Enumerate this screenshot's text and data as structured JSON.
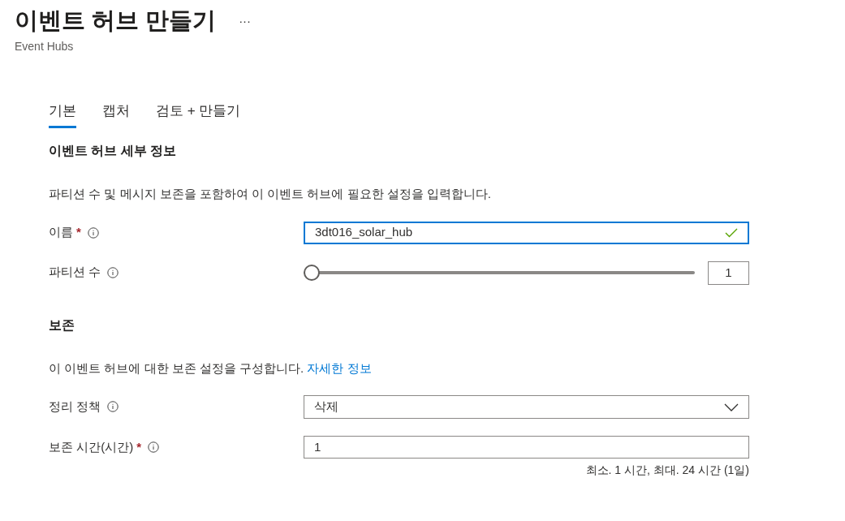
{
  "header": {
    "title": "이벤트 허브 만들기",
    "more": "···",
    "subtitle": "Event Hubs"
  },
  "tabs": [
    {
      "label": "기본",
      "selected": true
    },
    {
      "label": "캡처",
      "selected": false
    },
    {
      "label": "검토 + 만들기",
      "selected": false
    }
  ],
  "sections": [
    {
      "heading": "이벤트 허브 세부 정보",
      "description": "파티션 수 및 메시지 보존을 포함하여 이 이벤트 허브에 필요한 설정을 입력합니다.",
      "fields": [
        {
          "kind": "text",
          "label": "이름",
          "required_mark": "*",
          "value": "3dt016_solar_hub",
          "valid": true
        },
        {
          "kind": "slider",
          "label": "파티션 수",
          "level": 0,
          "value": "1"
        }
      ]
    },
    {
      "heading": "보존",
      "description": "이 이벤트 허브에 대한 보존 설정을 구성합니다.",
      "link": "자세한 정보",
      "fields": [
        {
          "kind": "dropdown",
          "label": "정리 정책",
          "value": "삭제"
        },
        {
          "kind": "text",
          "label": "보존 시간(시간)",
          "required_mark": "*",
          "value": "1",
          "valid": false,
          "hint": "최소. 1 시간, 최대. 24 시간 (1일)"
        }
      ]
    }
  ]
}
